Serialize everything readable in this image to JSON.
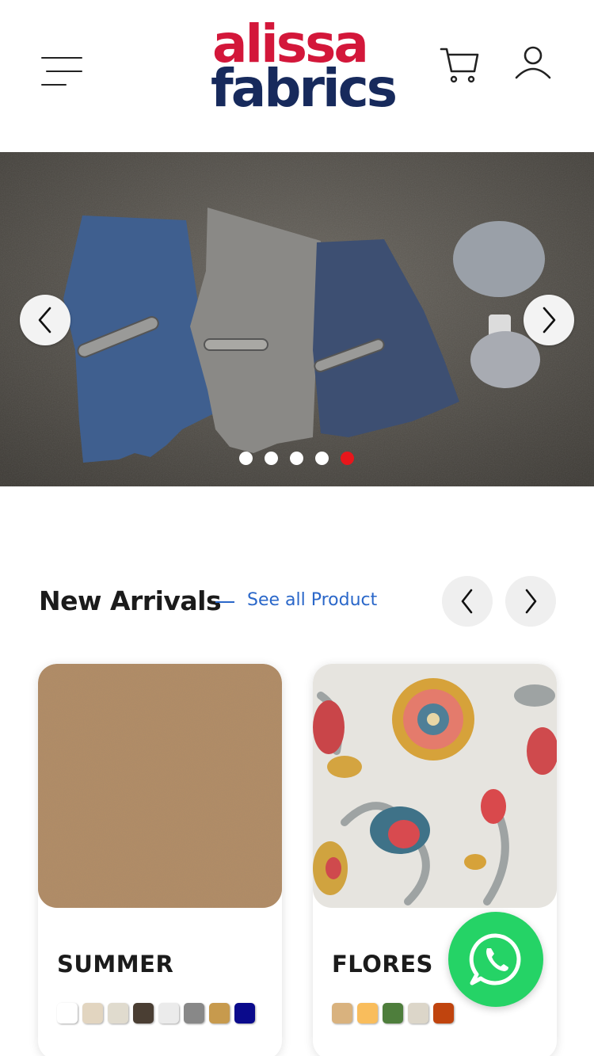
{
  "header": {
    "logo_line1": "alissa",
    "logo_line2": "fabrics",
    "colors": {
      "logo_top": "#d3173a",
      "logo_bottom": "#172a5c"
    },
    "icons": [
      "menu-icon",
      "cart-icon",
      "user-icon"
    ]
  },
  "hero": {
    "slide_count": 5,
    "active_slide": 5,
    "colors": {
      "active_dot": "#e8161b",
      "dot": "#ffffff"
    },
    "icons": [
      "chevron-left-icon",
      "chevron-right-icon"
    ]
  },
  "new_arrivals": {
    "title": "New Arrivals",
    "see_all_label": "See all Product",
    "accent_color": "#2a67c9",
    "products": [
      {
        "name": "SUMMER",
        "swatches": [
          "#ffffff",
          "#e2d5c0",
          "#e0dbce",
          "#4a3e33",
          "#ebebeb",
          "#888888",
          "#c79a4d",
          "#0a0a8c"
        ]
      },
      {
        "name": "FLORES",
        "swatches": [
          "#d9b27e",
          "#f9bd5c",
          "#4e7e3c",
          "#dcd6c9",
          "#c0440e"
        ]
      }
    ]
  },
  "whatsapp": {
    "icon": "whatsapp-icon",
    "color": "#25d366"
  }
}
